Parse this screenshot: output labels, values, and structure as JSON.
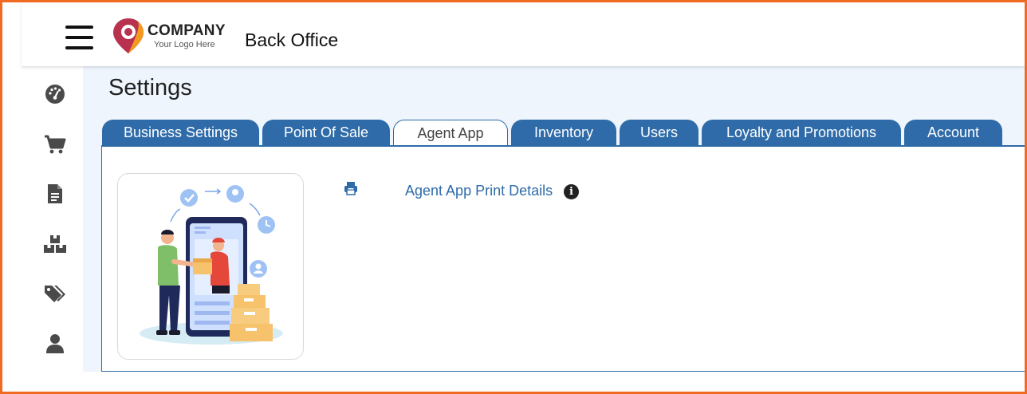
{
  "header": {
    "logo_company": "COMPANY",
    "logo_tagline": "Your Logo Here",
    "app_title": "Back Office",
    "menu_icon": "hamburger-menu-icon",
    "brand_colors": {
      "logo_red": "#b8324f",
      "logo_orange": "#f39a1e"
    }
  },
  "sidebar": {
    "items": [
      {
        "icon": "dashboard-gauge-icon"
      },
      {
        "icon": "shopping-cart-icon"
      },
      {
        "icon": "document-icon"
      },
      {
        "icon": "boxes-icon"
      },
      {
        "icon": "tags-icon"
      },
      {
        "icon": "user-icon"
      }
    ]
  },
  "page": {
    "title": "Settings"
  },
  "tabs": [
    {
      "label": "Business Settings",
      "active": false
    },
    {
      "label": "Point Of Sale",
      "active": false
    },
    {
      "label": "Agent App",
      "active": true
    },
    {
      "label": "Inventory",
      "active": false
    },
    {
      "label": "Users",
      "active": false
    },
    {
      "label": "Loyalty and Promotions",
      "active": false
    },
    {
      "label": "Account",
      "active": false
    }
  ],
  "content": {
    "print_icon": "printer-icon",
    "link_label": "Agent App Print Details",
    "info_icon": "info-circle-icon",
    "info_glyph": "i",
    "illustration": "delivery-agent-illustration"
  },
  "colors": {
    "accent": "#2e6ba8",
    "frame": "#f06a22",
    "main_bg": "#eef5fc",
    "icon_gray": "#4a4a4a"
  }
}
